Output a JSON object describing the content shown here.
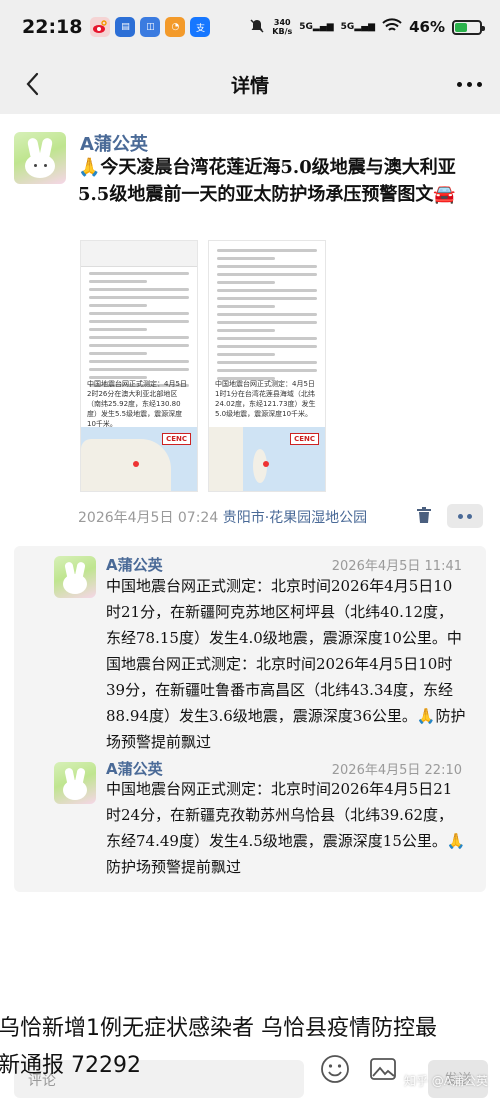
{
  "status_bar": {
    "time": "22:18",
    "network_speed": "340\nKB/s",
    "network1": "5G",
    "network2": "5G",
    "battery_percent": "46%",
    "battery_level": 0.46,
    "app_icons": [
      "weibo-icon",
      "toutiao-news-icon",
      "app-store-icon",
      "orange-app-icon",
      "alipay-icon"
    ]
  },
  "nav": {
    "title": "详情"
  },
  "post": {
    "author": "A蒲公英",
    "text": "🙏今天凌晨台湾花莲近海5.0级地震与澳大利亚5.5级地震前一天的亚太防护场承压预警图文🚘",
    "left_image_caption": "中国地震台网正式测定：4月5日2时26分在澳大利亚北部地区（南纬25.92度，东经130.80度）发生5.5级地震，震源深度10千米。",
    "right_image_caption": "中国地震台网正式测定：4月5日1时1分在台湾花莲县海域（北纬24.02度，东经121.73度）发生5.0级地震，震源深度10千米。",
    "map_badge": "CENC",
    "date": "2026年4月5日 07:24",
    "location": "贵阳市·花果园湿地公园"
  },
  "comments": [
    {
      "author": "A蒲公英",
      "time": "2026年4月5日 11:41",
      "text": "中国地震台网正式测定：北京时间2026年4月5日10时21分，在新疆阿克苏地区柯坪县（北纬40.12度，东经78.15度）发生4.0级地震，震源深度10公里。中国地震台网正式测定：北京时间2026年4月5日10时39分，在新疆吐鲁番市高昌区（北纬43.34度，东经88.94度）发生3.6级地震，震源深度36公里。🙏防护场预警提前飘过"
    },
    {
      "author": "A蒲公英",
      "time": "2026年4月5日 22:10",
      "text": "中国地震台网正式测定：北京时间2026年4月5日21时24分，在新疆克孜勒苏州乌恰县（北纬39.62度，东经74.49度）发生4.5级地震，震源深度15公里。🙏防护场预警提前飘过"
    }
  ],
  "bottom_bar": {
    "comment_placeholder": "评论",
    "send_label": "发送",
    "watermark": "知乎 @A蒲公英"
  },
  "overlay": {
    "line1": "乌恰新增1例无症状感染者  乌恰县疫情防控最",
    "line2": "新通报  72292"
  }
}
